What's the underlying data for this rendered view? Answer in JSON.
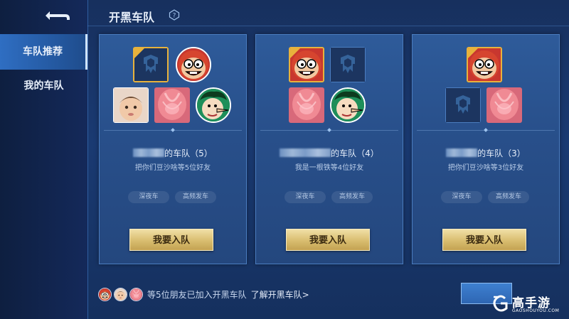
{
  "sidebar": {
    "items": [
      {
        "label": "车队推荐",
        "active": true
      },
      {
        "label": "我的车队",
        "active": false
      }
    ]
  },
  "header": {
    "title": "开黑车队"
  },
  "cards": [
    {
      "name_suffix": "的车队（5）",
      "subtitle": "把你们豆沙啥等5位好友",
      "tags": [
        "深夜车",
        "高频发车"
      ],
      "button": "我要入队"
    },
    {
      "name_suffix": "的车队（4）",
      "subtitle": "我是一根铁等4位好友",
      "tags": [
        "深夜车",
        "高频发车"
      ],
      "button": "我要入队"
    },
    {
      "name_suffix": "的车队（3）",
      "subtitle": "把你们豆沙啥等3位好友",
      "tags": [
        "深夜车",
        "高频发车"
      ],
      "button": "我要入队"
    }
  ],
  "footer": {
    "joined_text": "等5位朋友已加入开黑车队",
    "learn_more": "了解开黑车队>"
  },
  "watermark": {
    "brand": "高手游",
    "url": "GAOSHOUYOU.COM"
  },
  "colors": {
    "accent_gold": "#d9bd6f",
    "panel_blue": "#2e5b9a",
    "bg_blue": "#1a3a72"
  }
}
